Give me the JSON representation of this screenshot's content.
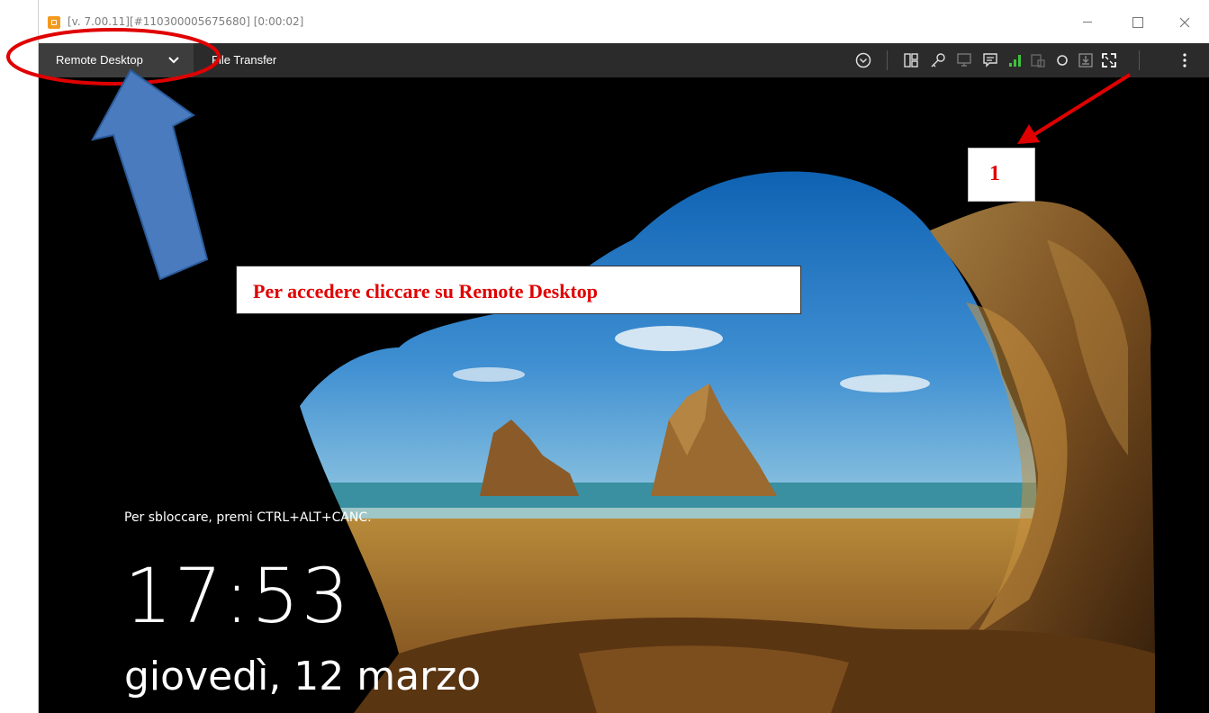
{
  "window": {
    "title": "[v. 7.00.11][#110300005675680] [0:00:02]"
  },
  "toolbar": {
    "remote_desktop_label": "Remote Desktop",
    "file_transfer_label": "File Transfer"
  },
  "lockscreen": {
    "unlock_hint": "Per sbloccare, premi CTRL+ALT+CANC.",
    "time": "17:53",
    "date": "giovedì, 12 marzo"
  },
  "annotations": {
    "instruction": "Per accedere cliccare su Remote Desktop",
    "marker_number": "1",
    "colors": {
      "red": "#e00000",
      "arrow_blue": "#4a7bbf"
    }
  },
  "icons": [
    "collapse-circle-icon",
    "layout-icon",
    "key-icon",
    "monitor-icon",
    "chat-icon",
    "signal-icon",
    "device-icon",
    "record-icon",
    "download-icon",
    "fullscreen-icon",
    "more-vertical-icon"
  ]
}
